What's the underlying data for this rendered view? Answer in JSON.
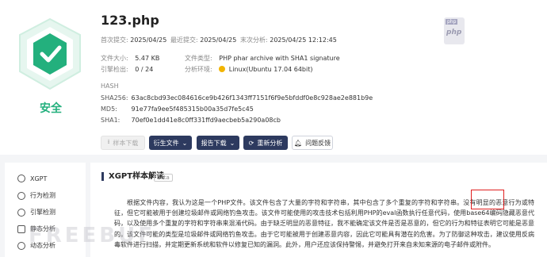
{
  "file": {
    "name": "123.php",
    "verdict": "安全",
    "type_icon": "php",
    "first_submit_label": "首次提交:",
    "first_submit": "2025/04/25",
    "last_submit_label": "最近提交:",
    "last_submit": "2025/04/25",
    "last_analysis_label": "末次分析:",
    "last_analysis": "2025/04/25 12:12:45",
    "size_label": "文件大小:",
    "size": "5.47 KB",
    "filetype_label": "文件类型:",
    "filetype": "PHP phar archive with SHA1 signature",
    "engine_label": "引擎检出:",
    "engine": "0 / 24",
    "env_label": "分析环境:",
    "env": "Linux(Ubuntu 17.04 64bit)"
  },
  "hash": {
    "heading": "HASH",
    "rows": [
      {
        "k": "SHA256:",
        "v": "63ac8cbd93ec084616ce9b426f1343ff7151f6f9e5bfddf0e8c928ae2e881b9e"
      },
      {
        "k": "MD5:",
        "v": "91e77fa9ee5f485315b00a35d7fe5c45"
      },
      {
        "k": "SHA1:",
        "v": "70ef0e1dd41e8c0ff331ffd9aecbeb5a290a08cb"
      }
    ]
  },
  "toolbar": {
    "download": "样本下载",
    "derive": "衍生文件",
    "report": "报告下载",
    "reanalyze": "重新分析",
    "feedback": "问题反馈"
  },
  "sidebar": {
    "items": [
      {
        "label": "XGPT",
        "icon": "xgpt-icon"
      },
      {
        "label": "行为检测",
        "icon": "behavior-icon"
      },
      {
        "label": "引擎检测",
        "icon": "engine-icon"
      },
      {
        "label": "静态分析",
        "icon": "static-icon"
      },
      {
        "label": "动态分析",
        "icon": "dynamic-icon"
      }
    ]
  },
  "main": {
    "title": "XGPT样本解读",
    "beta": "beta",
    "text": "根据文件内容，我认为这是一个PHP文件。该文件包含了大量的字符和字符串，其中包含了多个重复的字符和字符串。没有明显的恶意行为或特征，但它可能被用于创建垃圾邮件或网络钓鱼攻击。该文件可能使用的攻击技术包括利用PHP的eval函数执行任意代码，使用base64编码隐藏恶意代码，以及使用多个重复的字符和字符串来混淆代码。由于缺乏明显的恶意特征，我不能确定该文件是否是恶意的，但它的行为和特征表明它可能是恶意的。该文件可能的类型是垃圾邮件或网络钓鱼攻击。由于它可能被用于创建恶意内容，因此它可能具有潜在的危害。为了防御这种攻击，建议使用反病毒软件进行扫描，并定期更新系统和软件以修复已知的漏洞。此外，用户还应该保持警惕，并避免打开来自未知来源的电子邮件或附件。"
  },
  "watermark": "FREEBUF",
  "colors": {
    "safe": "#23b07d",
    "accent": "#2d3a5f",
    "highlight": "#e02020"
  }
}
